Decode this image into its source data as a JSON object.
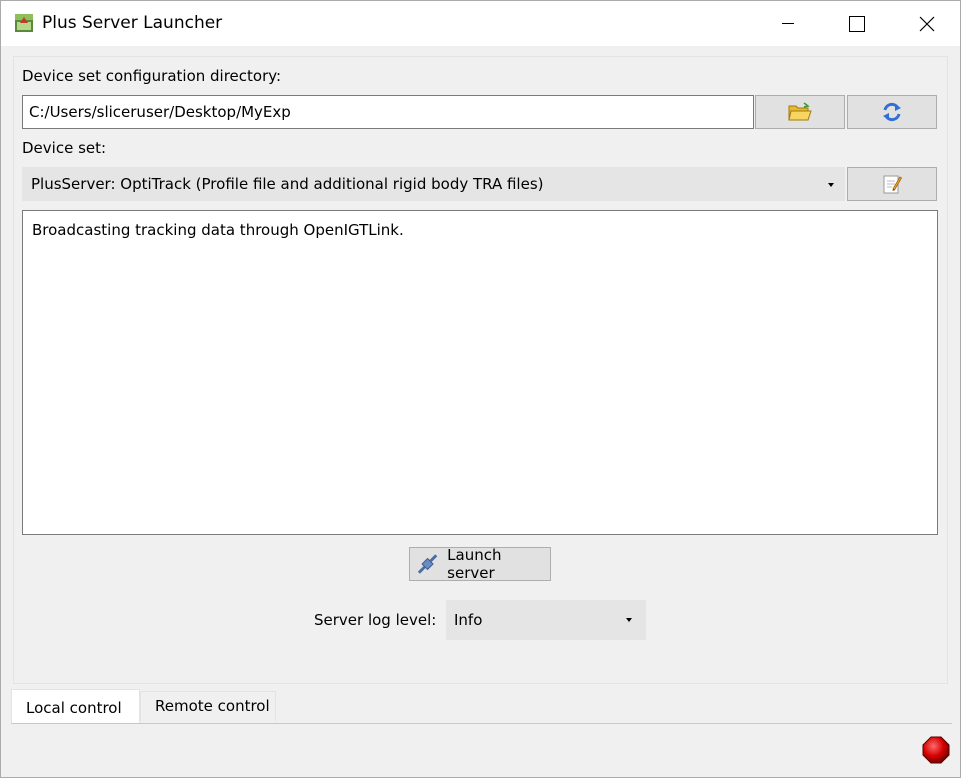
{
  "window": {
    "title": "Plus Server Launcher",
    "icon": "plus-server-app-icon",
    "controls": [
      "minimize-icon",
      "maximize-icon",
      "close-icon"
    ]
  },
  "config": {
    "directory_label": "Device set configuration directory:",
    "directory_value": "C:/Users/sliceruser/Desktop/MyExp",
    "open_folder_icon": "open-folder-icon",
    "refresh_icon": "refresh-icon"
  },
  "device_set": {
    "label": "Device set:",
    "selected": "PlusServer: OptiTrack (Profile file and additional rigid body TRA files)",
    "edit_icon": "edit-config-icon"
  },
  "description": {
    "text": "Broadcasting tracking data through OpenIGTLink."
  },
  "launch": {
    "label": "Launch server",
    "icon": "connect-plug-icon"
  },
  "log_level": {
    "label": "Server log level:",
    "selected": "Info"
  },
  "tabs": [
    {
      "label": "Local control",
      "active": true
    },
    {
      "label": "Remote control",
      "active": false
    }
  ],
  "status": {
    "icon": "status-red-led-icon",
    "color": "#d40000"
  },
  "colors": {
    "window_bg": "#f0f0f0",
    "titlebar_bg": "#ffffff",
    "button_bg": "#e1e1e1",
    "combo_bg": "#e5e5e5"
  }
}
